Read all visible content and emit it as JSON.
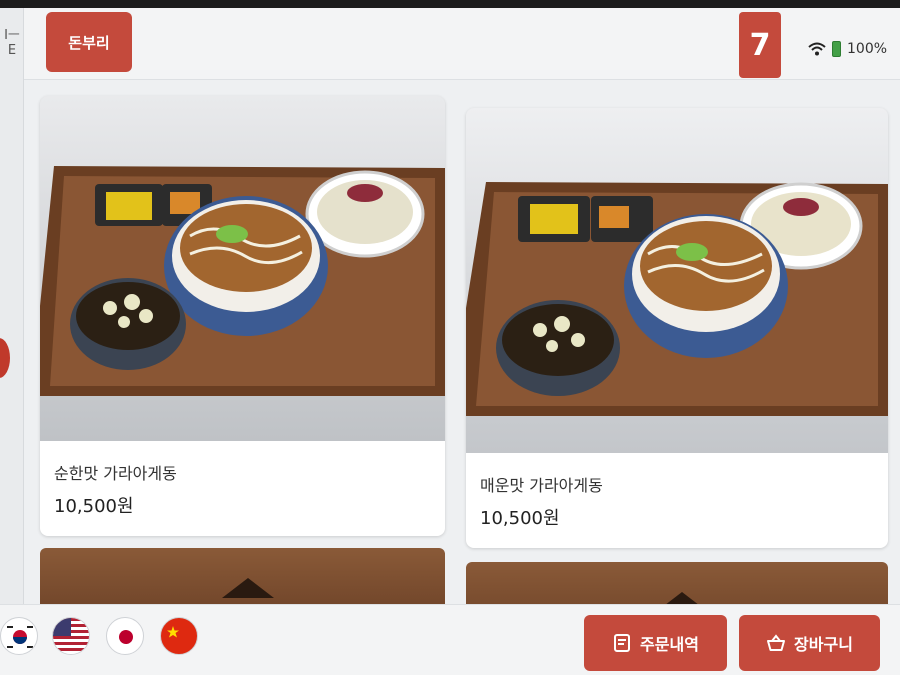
{
  "header": {
    "side_label": "Iㅡ\nE",
    "category_tab": "돈부리",
    "cart_count": "7",
    "battery": "100%"
  },
  "menu": {
    "items": [
      {
        "name": "순한맛 가라아게동",
        "price": "10,500원"
      },
      {
        "name": "매운맛 가라아게동",
        "price": "10,500원"
      }
    ]
  },
  "footer": {
    "languages": [
      "korean-flag-icon",
      "us-flag-icon",
      "japan-flag-icon",
      "china-flag-icon"
    ],
    "order_history_label": "주문내역",
    "cart_label": "장바구니"
  },
  "colors": {
    "accent": "#c44a3c",
    "background": "#eef0f2"
  }
}
